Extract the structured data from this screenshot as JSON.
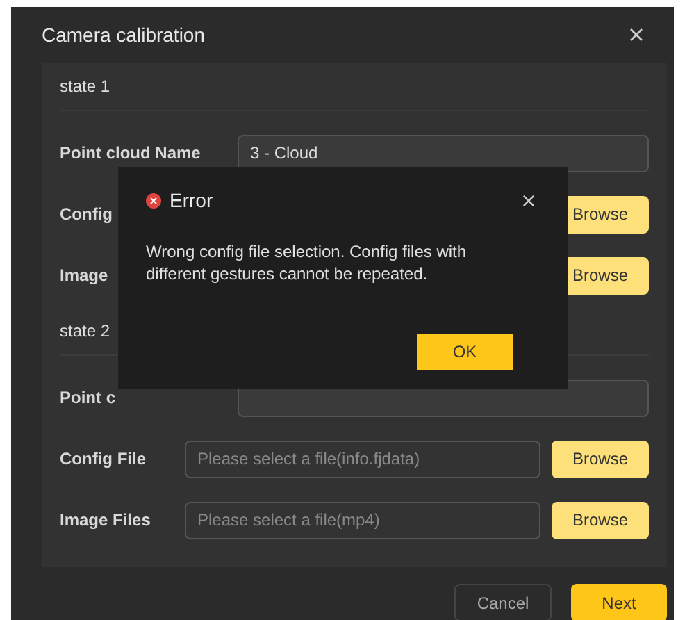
{
  "window": {
    "title": "Camera calibration"
  },
  "states": [
    {
      "heading": "state 1",
      "rows": [
        {
          "kind": "text",
          "label": "Point cloud Name",
          "value": "3 - Cloud"
        },
        {
          "kind": "file",
          "label": "Config",
          "button": "Browse"
        },
        {
          "kind": "file",
          "label": "Image",
          "button": "Browse"
        }
      ]
    },
    {
      "heading": "state 2",
      "rows": [
        {
          "kind": "text",
          "label": "Point c"
        },
        {
          "kind": "file",
          "label": "Config File",
          "placeholder": "Please select a file(info.fjdata)",
          "button": "Browse"
        },
        {
          "kind": "file",
          "label": "Image Files",
          "placeholder": "Please select a file(mp4)",
          "button": "Browse"
        }
      ]
    }
  ],
  "footer": {
    "cancel": "Cancel",
    "next": "Next"
  },
  "error_dialog": {
    "title": "Error",
    "message": "Wrong config file selection. Config files with different gestures cannot be repeated.",
    "button": "OK"
  }
}
